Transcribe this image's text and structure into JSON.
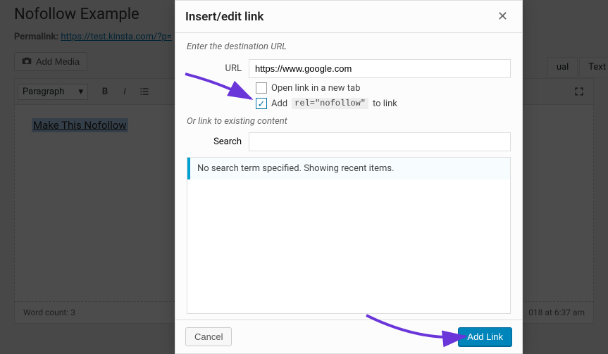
{
  "editor": {
    "title": "Nofollow Example",
    "permalink_label": "Permalink:",
    "permalink_url": "https://test.kinsta.com/?p=",
    "add_media_label": "Add Media",
    "format_select": "Paragraph",
    "tabs": {
      "visual": "ual",
      "text": "Text"
    },
    "content_highlight": "Make This Nofollow",
    "word_count_label": "Word count:",
    "word_count": "3",
    "draft_saved": "018 at 6:37 am"
  },
  "modal": {
    "title": "Insert/edit link",
    "enter_url_label": "Enter the destination URL",
    "url_label": "URL",
    "url_value": "https://www.google.com",
    "new_tab_label": "Open link in a new tab",
    "new_tab_checked": false,
    "nofollow_prefix": "Add",
    "nofollow_code": "rel=\"nofollow\"",
    "nofollow_suffix": "to link",
    "nofollow_checked": true,
    "existing_label": "Or link to existing content",
    "search_label": "Search",
    "search_value": "",
    "info_text": "No search term specified. Showing recent items.",
    "cancel_label": "Cancel",
    "submit_label": "Add Link"
  },
  "colors": {
    "arrow": "#6a35d9",
    "primary": "#0085ba"
  }
}
